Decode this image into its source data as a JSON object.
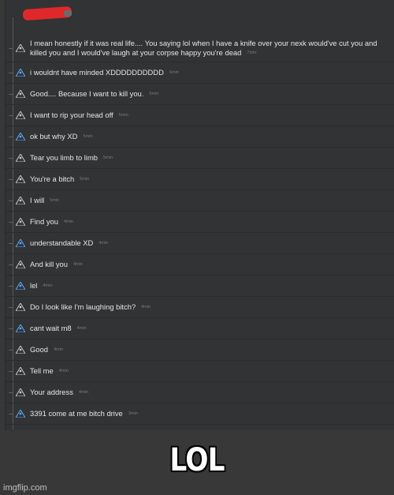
{
  "colors": {
    "page_bg": "#383838",
    "chat_bg": "#323334",
    "text": "#e6e6e6",
    "time": "#7a7a7a",
    "censor": "#e0282b",
    "icon_blue": "#5aa9ff",
    "icon_grey": "#c8c8c8"
  },
  "messages": [
    {
      "text": "I mean honestly if it was real life.... You saying lol when I have a knife over your nexk would've cut you and killed you and I would've laugh at your corpse happy you're dead",
      "time": "7min",
      "icon": "grey-user-icon",
      "tall": true
    },
    {
      "text": "i wouldnt have minded XDDDDDDDDDD",
      "time": "6min",
      "icon": "blue-user-icon",
      "tall": false
    },
    {
      "text": "Good.... Because I want to kill you.",
      "time": "5min",
      "icon": "grey-user-icon",
      "tall": false
    },
    {
      "text": "I want to rip your head off",
      "time": "5min",
      "icon": "grey-user-icon",
      "tall": false
    },
    {
      "text": "ok but why XD",
      "time": "5min",
      "icon": "blue-user-icon",
      "tall": false
    },
    {
      "text": "Tear you limb to limb",
      "time": "5min",
      "icon": "grey-user-icon",
      "tall": false
    },
    {
      "text": "You're a bitch",
      "time": "5min",
      "icon": "grey-user-icon",
      "tall": false
    },
    {
      "text": "I will",
      "time": "5min",
      "icon": "grey-user-icon",
      "tall": false
    },
    {
      "text": "Find you",
      "time": "4min",
      "icon": "grey-user-icon",
      "tall": false
    },
    {
      "text": "understandable XD",
      "time": "4min",
      "icon": "blue-user-icon",
      "tall": false
    },
    {
      "text": "And kill you",
      "time": "4min",
      "icon": "grey-user-icon",
      "tall": false
    },
    {
      "text": "lel",
      "time": "4min",
      "icon": "blue-user-icon",
      "tall": false
    },
    {
      "text": "Do I look like I'm laughing bitch?",
      "time": "4min",
      "icon": "grey-user-icon",
      "tall": false
    },
    {
      "text": "cant wait m8",
      "time": "4min",
      "icon": "blue-user-icon",
      "tall": false
    },
    {
      "text": "Good",
      "time": "4min",
      "icon": "grey-user-icon",
      "tall": false
    },
    {
      "text": "Tell me",
      "time": "4min",
      "icon": "grey-user-icon",
      "tall": false
    },
    {
      "text": "Your address",
      "time": "4min",
      "icon": "grey-user-icon",
      "tall": false
    },
    {
      "text": "3391 come at me bitch drive",
      "time": "3min",
      "icon": "blue-user-icon",
      "tall": false
    }
  ],
  "caption": "LOL",
  "watermark": "imgflip.com"
}
